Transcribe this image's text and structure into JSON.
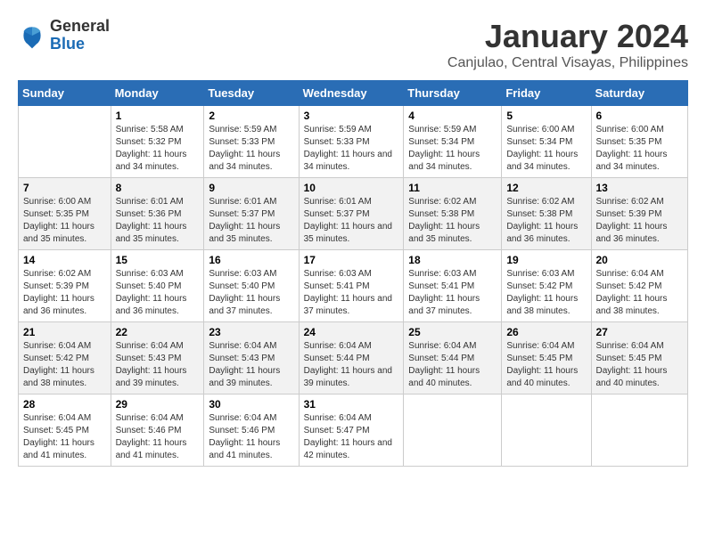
{
  "logo": {
    "line1": "General",
    "line2": "Blue"
  },
  "title": "January 2024",
  "location": "Canjulao, Central Visayas, Philippines",
  "days_of_week": [
    "Sunday",
    "Monday",
    "Tuesday",
    "Wednesday",
    "Thursday",
    "Friday",
    "Saturday"
  ],
  "weeks": [
    [
      {
        "day": "",
        "sunrise": "",
        "sunset": "",
        "daylight": ""
      },
      {
        "day": "1",
        "sunrise": "Sunrise: 5:58 AM",
        "sunset": "Sunset: 5:32 PM",
        "daylight": "Daylight: 11 hours and 34 minutes."
      },
      {
        "day": "2",
        "sunrise": "Sunrise: 5:59 AM",
        "sunset": "Sunset: 5:33 PM",
        "daylight": "Daylight: 11 hours and 34 minutes."
      },
      {
        "day": "3",
        "sunrise": "Sunrise: 5:59 AM",
        "sunset": "Sunset: 5:33 PM",
        "daylight": "Daylight: 11 hours and 34 minutes."
      },
      {
        "day": "4",
        "sunrise": "Sunrise: 5:59 AM",
        "sunset": "Sunset: 5:34 PM",
        "daylight": "Daylight: 11 hours and 34 minutes."
      },
      {
        "day": "5",
        "sunrise": "Sunrise: 6:00 AM",
        "sunset": "Sunset: 5:34 PM",
        "daylight": "Daylight: 11 hours and 34 minutes."
      },
      {
        "day": "6",
        "sunrise": "Sunrise: 6:00 AM",
        "sunset": "Sunset: 5:35 PM",
        "daylight": "Daylight: 11 hours and 34 minutes."
      }
    ],
    [
      {
        "day": "7",
        "sunrise": "Sunrise: 6:00 AM",
        "sunset": "Sunset: 5:35 PM",
        "daylight": "Daylight: 11 hours and 35 minutes."
      },
      {
        "day": "8",
        "sunrise": "Sunrise: 6:01 AM",
        "sunset": "Sunset: 5:36 PM",
        "daylight": "Daylight: 11 hours and 35 minutes."
      },
      {
        "day": "9",
        "sunrise": "Sunrise: 6:01 AM",
        "sunset": "Sunset: 5:37 PM",
        "daylight": "Daylight: 11 hours and 35 minutes."
      },
      {
        "day": "10",
        "sunrise": "Sunrise: 6:01 AM",
        "sunset": "Sunset: 5:37 PM",
        "daylight": "Daylight: 11 hours and 35 minutes."
      },
      {
        "day": "11",
        "sunrise": "Sunrise: 6:02 AM",
        "sunset": "Sunset: 5:38 PM",
        "daylight": "Daylight: 11 hours and 35 minutes."
      },
      {
        "day": "12",
        "sunrise": "Sunrise: 6:02 AM",
        "sunset": "Sunset: 5:38 PM",
        "daylight": "Daylight: 11 hours and 36 minutes."
      },
      {
        "day": "13",
        "sunrise": "Sunrise: 6:02 AM",
        "sunset": "Sunset: 5:39 PM",
        "daylight": "Daylight: 11 hours and 36 minutes."
      }
    ],
    [
      {
        "day": "14",
        "sunrise": "Sunrise: 6:02 AM",
        "sunset": "Sunset: 5:39 PM",
        "daylight": "Daylight: 11 hours and 36 minutes."
      },
      {
        "day": "15",
        "sunrise": "Sunrise: 6:03 AM",
        "sunset": "Sunset: 5:40 PM",
        "daylight": "Daylight: 11 hours and 36 minutes."
      },
      {
        "day": "16",
        "sunrise": "Sunrise: 6:03 AM",
        "sunset": "Sunset: 5:40 PM",
        "daylight": "Daylight: 11 hours and 37 minutes."
      },
      {
        "day": "17",
        "sunrise": "Sunrise: 6:03 AM",
        "sunset": "Sunset: 5:41 PM",
        "daylight": "Daylight: 11 hours and 37 minutes."
      },
      {
        "day": "18",
        "sunrise": "Sunrise: 6:03 AM",
        "sunset": "Sunset: 5:41 PM",
        "daylight": "Daylight: 11 hours and 37 minutes."
      },
      {
        "day": "19",
        "sunrise": "Sunrise: 6:03 AM",
        "sunset": "Sunset: 5:42 PM",
        "daylight": "Daylight: 11 hours and 38 minutes."
      },
      {
        "day": "20",
        "sunrise": "Sunrise: 6:04 AM",
        "sunset": "Sunset: 5:42 PM",
        "daylight": "Daylight: 11 hours and 38 minutes."
      }
    ],
    [
      {
        "day": "21",
        "sunrise": "Sunrise: 6:04 AM",
        "sunset": "Sunset: 5:42 PM",
        "daylight": "Daylight: 11 hours and 38 minutes."
      },
      {
        "day": "22",
        "sunrise": "Sunrise: 6:04 AM",
        "sunset": "Sunset: 5:43 PM",
        "daylight": "Daylight: 11 hours and 39 minutes."
      },
      {
        "day": "23",
        "sunrise": "Sunrise: 6:04 AM",
        "sunset": "Sunset: 5:43 PM",
        "daylight": "Daylight: 11 hours and 39 minutes."
      },
      {
        "day": "24",
        "sunrise": "Sunrise: 6:04 AM",
        "sunset": "Sunset: 5:44 PM",
        "daylight": "Daylight: 11 hours and 39 minutes."
      },
      {
        "day": "25",
        "sunrise": "Sunrise: 6:04 AM",
        "sunset": "Sunset: 5:44 PM",
        "daylight": "Daylight: 11 hours and 40 minutes."
      },
      {
        "day": "26",
        "sunrise": "Sunrise: 6:04 AM",
        "sunset": "Sunset: 5:45 PM",
        "daylight": "Daylight: 11 hours and 40 minutes."
      },
      {
        "day": "27",
        "sunrise": "Sunrise: 6:04 AM",
        "sunset": "Sunset: 5:45 PM",
        "daylight": "Daylight: 11 hours and 40 minutes."
      }
    ],
    [
      {
        "day": "28",
        "sunrise": "Sunrise: 6:04 AM",
        "sunset": "Sunset: 5:45 PM",
        "daylight": "Daylight: 11 hours and 41 minutes."
      },
      {
        "day": "29",
        "sunrise": "Sunrise: 6:04 AM",
        "sunset": "Sunset: 5:46 PM",
        "daylight": "Daylight: 11 hours and 41 minutes."
      },
      {
        "day": "30",
        "sunrise": "Sunrise: 6:04 AM",
        "sunset": "Sunset: 5:46 PM",
        "daylight": "Daylight: 11 hours and 41 minutes."
      },
      {
        "day": "31",
        "sunrise": "Sunrise: 6:04 AM",
        "sunset": "Sunset: 5:47 PM",
        "daylight": "Daylight: 11 hours and 42 minutes."
      },
      {
        "day": "",
        "sunrise": "",
        "sunset": "",
        "daylight": ""
      },
      {
        "day": "",
        "sunrise": "",
        "sunset": "",
        "daylight": ""
      },
      {
        "day": "",
        "sunrise": "",
        "sunset": "",
        "daylight": ""
      }
    ]
  ]
}
